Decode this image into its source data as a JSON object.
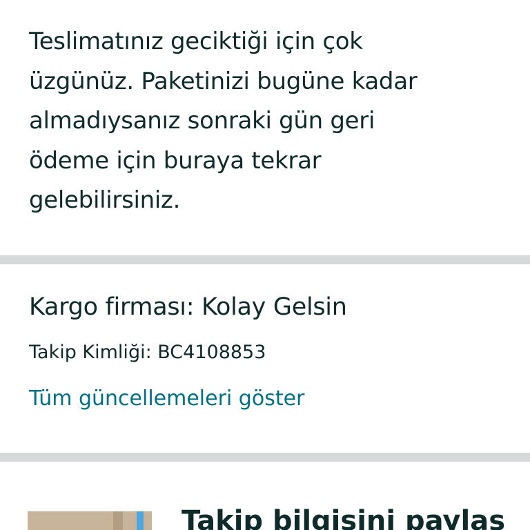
{
  "delay_notice": {
    "lines": [
      "Teslimatınız geciktiği için çok",
      "üzgünüz. Paketinizi bugüne kadar",
      "almadıysanız sonraki gün geri",
      "ödeme için buraya tekrar",
      "gelebilirsiniz."
    ]
  },
  "shipment": {
    "carrier_text": "Kargo firması: Kolay Gelsin",
    "tracking_text": "Takip Kimliği: BC4108853",
    "show_updates_link": "Tüm güncellemeleri göster"
  },
  "share": {
    "title": "Takip bilgisini paylaş",
    "thumbnail_icon": "package-box-image"
  },
  "colors": {
    "text": "#0f2a2a",
    "link": "#007185",
    "divider": "#d5d9d9"
  }
}
